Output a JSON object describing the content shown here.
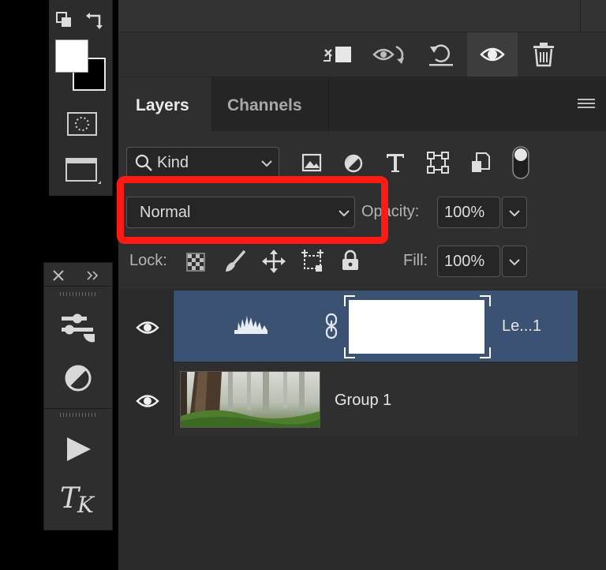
{
  "tabs": [
    {
      "label": "Layers",
      "active": true
    },
    {
      "label": "Channels",
      "active": false
    }
  ],
  "filter": {
    "kind_label": "Kind"
  },
  "blend_mode": {
    "selected": "Normal"
  },
  "opacity": {
    "label": "Opacity:",
    "value": "100%"
  },
  "lock": {
    "label": "Lock:"
  },
  "fill": {
    "label": "Fill:",
    "value": "100%"
  },
  "layers": [
    {
      "name": "Le...1",
      "selected": true
    },
    {
      "name": "Group 1",
      "selected": false
    }
  ],
  "icons": {
    "action_bar": [
      "link-layers-icon",
      "visibility-cycle-icon",
      "reset-icon",
      "eye-icon",
      "trash-icon"
    ],
    "filter_bar": [
      "image-filter-icon",
      "adjustment-filter-icon",
      "type-filter-icon",
      "shape-filter-icon",
      "smart-object-filter-icon",
      "filter-toggle-icon"
    ],
    "lock_bar": [
      "lock-pixels-icon",
      "lock-brush-icon",
      "lock-position-icon",
      "lock-artboard-icon",
      "lock-all-icon"
    ],
    "tools": [
      "swap-colors-icon",
      "quick-mask-icon",
      "screen-mode-icon",
      "properties-icon",
      "adjustments-icon",
      "play-icon",
      "type-k-icon"
    ]
  },
  "colors": {
    "selected_row": "#3c5272",
    "highlight": "#ff1a14",
    "panel_bg": "#2f2f2f"
  }
}
